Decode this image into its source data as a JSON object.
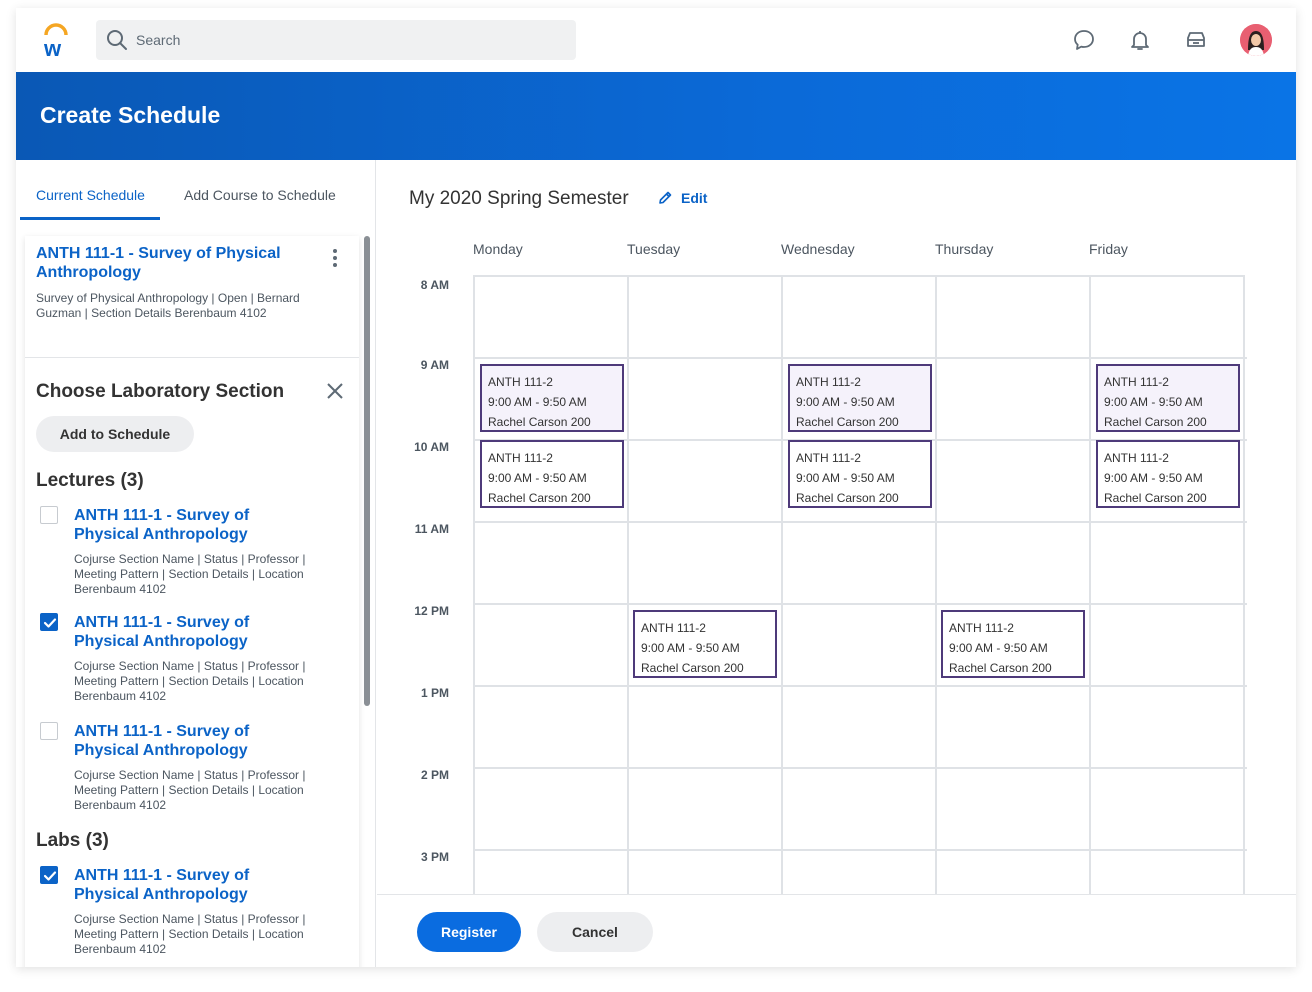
{
  "header": {
    "search_placeholder": "Search"
  },
  "banner": {
    "title": "Create Schedule"
  },
  "left": {
    "tabs": [
      {
        "label": "Current Schedule"
      },
      {
        "label": "Add Course to Schedule"
      }
    ],
    "card": {
      "title": "ANTH 111-1 - Survey of Physical Anthropology",
      "detail": "Survey of Physical Anthropology   |   Open   |   Bernard Guzman | Section Details Berenbaum 4102"
    },
    "choose_title": "Choose Laboratory Section",
    "add_button": "Add to Schedule",
    "lectures_title": "Lectures (3)",
    "labs_title": "Labs (3)",
    "lectures": [
      {
        "title": "ANTH 111-1 - Survey of Physical Anthropology",
        "detail": "Cojurse Section Name |  Status  |  Professor |  Meeting Pattern | Section Details | Location Berenbaum 4102",
        "checked": false
      },
      {
        "title": "ANTH 111-1 - Survey of Physical Anthropology",
        "detail": "Cojurse Section Name |  Status  |  Professor |  Meeting Pattern | Section Details | Location Berenbaum 4102",
        "checked": true
      },
      {
        "title": "ANTH 111-1 - Survey of Physical Anthropology",
        "detail": "Cojurse Section Name |  Status  |  Professor |  Meeting Pattern | Section Details | Location Berenbaum 4102",
        "checked": false
      }
    ],
    "labs": [
      {
        "title": "ANTH 111-1 - Survey of Physical Anthropology",
        "detail": "Cojurse Section Name |  Status  |  Professor |  Meeting Pattern | Section Details | Location Berenbaum 4102",
        "checked": true
      }
    ]
  },
  "schedule": {
    "title": "My 2020 Spring Semester",
    "edit_label": "Edit",
    "days": [
      "Monday",
      "Tuesday",
      "Wednesday",
      "Thursday",
      "Friday"
    ],
    "hours": [
      "8 AM",
      "9 AM",
      "10 AM",
      "11 AM",
      "12 PM",
      "1 PM",
      "2 PM",
      "3 PM"
    ],
    "events": [
      {
        "day": "Monday",
        "slot": "9 AM",
        "course": "ANTH 111-2",
        "time": "9:00 AM - 9:50 AM",
        "location": "Rachel Carson 200"
      },
      {
        "day": "Monday",
        "slot": "10 AM",
        "course": "ANTH 111-2",
        "time": "9:00 AM - 9:50 AM",
        "location": "Rachel Carson 200"
      },
      {
        "day": "Wednesday",
        "slot": "9 AM",
        "course": "ANTH 111-2",
        "time": "9:00 AM - 9:50 AM",
        "location": "Rachel Carson 200"
      },
      {
        "day": "Wednesday",
        "slot": "10 AM",
        "course": "ANTH 111-2",
        "time": "9:00 AM - 9:50 AM",
        "location": "Rachel Carson 200"
      },
      {
        "day": "Friday",
        "slot": "9 AM",
        "course": "ANTH 111-2",
        "time": "9:00 AM - 9:50 AM",
        "location": "Rachel Carson 200"
      },
      {
        "day": "Friday",
        "slot": "10 AM",
        "course": "ANTH 111-2",
        "time": "9:00 AM - 9:50 AM",
        "location": "Rachel Carson 200"
      },
      {
        "day": "Tuesday",
        "slot": "12 PM",
        "course": "ANTH 111-2",
        "time": "9:00 AM - 9:50 AM",
        "location": "Rachel Carson 200"
      },
      {
        "day": "Thursday",
        "slot": "12 PM",
        "course": "ANTH 111-2",
        "time": "9:00 AM - 9:50 AM",
        "location": "Rachel Carson 200"
      }
    ]
  },
  "footer": {
    "register": "Register",
    "cancel": "Cancel"
  },
  "colors": {
    "accent": "#0b63c7",
    "banner": "#0a6ce0",
    "event_border": "#4e3a7a",
    "event_fill": "#f5f2fb"
  }
}
